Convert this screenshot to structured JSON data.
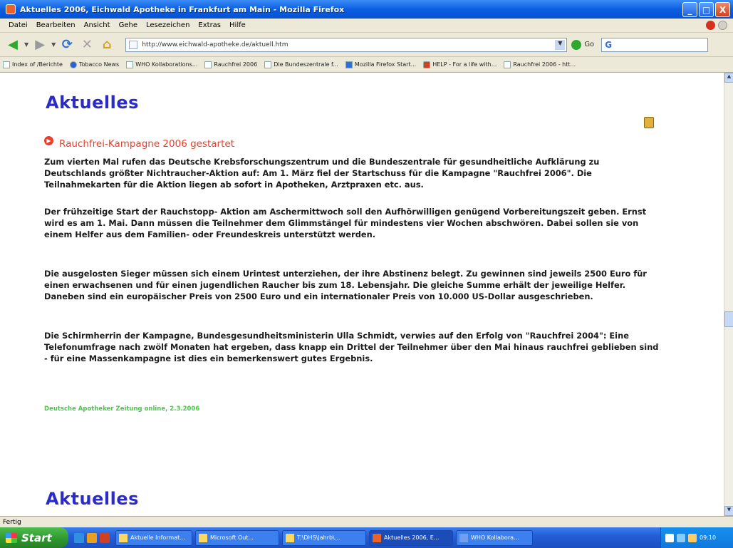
{
  "window": {
    "title": "Aktuelles 2006, Eichwald Apotheke in Frankfurt am Main - Mozilla Firefox",
    "controls": [
      "_",
      "□",
      "X"
    ]
  },
  "menu": [
    "Datei",
    "Bearbeiten",
    "Ansicht",
    "Gehe",
    "Lesezeichen",
    "Extras",
    "Hilfe"
  ],
  "toolbar": {
    "url": "http://www.eichwald-apotheke.de/aktuell.htm",
    "go_label": "Go",
    "search_placeholder": "G"
  },
  "bookmarks": [
    {
      "label": "Index of /Berichte",
      "icon": "page"
    },
    {
      "label": "Tobacco News",
      "icon": "google"
    },
    {
      "label": "WHO Kollaborations...",
      "icon": "page"
    },
    {
      "label": "Rauchfrei 2006",
      "icon": "page"
    },
    {
      "label": "Die Bundeszentrale f...",
      "icon": "page"
    },
    {
      "label": "Mozilla Firefox Start...",
      "icon": "firefox"
    },
    {
      "label": "HELP - For a life with...",
      "icon": "help"
    },
    {
      "label": "Rauchfrei 2006 - htt...",
      "icon": "page"
    }
  ],
  "content": {
    "heading": "Aktuelles",
    "heading_bottom": "Aktuelles",
    "news_title": "Rauchfrei-Kampagne 2006 gestartet",
    "paragraphs": [
      "Zum vierten Mal rufen das Deutsche Krebsforschungszentrum und die Bundeszentrale für gesundheitliche Aufklärung zu Deutschlands größter Nichtraucher-Aktion auf: Am 1. März fiel der Startschuss für die Kampagne \"Rauchfrei 2006\". Die Teilnahmekarten für die Aktion liegen ab sofort in Apotheken, Arztpraxen etc. aus.",
      "Der frühzeitige Start der Rauchstopp- Aktion am Aschermittwoch soll den Aufhörwilligen genügend Vorbereitungszeit geben. Ernst wird es am 1. Mai. Dann müssen die Teilnehmer dem Glimmstängel für mindestens vier Wochen abschwören. Dabei sollen sie von einem Helfer aus dem Familien- oder Freundeskreis unterstützt werden.",
      "Die ausgelosten Sieger müssen sich einem Urintest unterziehen, der ihre Abstinenz belegt. Zu gewinnen sind jeweils 2500 Euro für einen erwachsenen und für einen jugendlichen Raucher bis zum 18. Lebensjahr. Die gleiche Summe erhält der jeweilige Helfer. Daneben sind ein europäischer Preis von 2500 Euro und ein internationaler Preis von 10.000 US-Dollar ausgeschrieben.",
      "Die Schirmherrin der Kampagne, Bundesgesundheitsministerin Ulla Schmidt, verwies auf den Erfolg von \"Rauchfrei 2004\": Eine Telefonumfrage nach zwölf Monaten hat ergeben, dass knapp ein Drittel der Teilnehmer über den Mai hinaus rauchfrei geblieben sind - für eine Massenkampagne ist dies ein bemerkenswert gutes Ergebnis."
    ],
    "source": "Deutsche Apotheker Zeitung online, 2.3.2006"
  },
  "statusbar": {
    "text": "Fertig"
  },
  "taskbar": {
    "start_label": "Start",
    "tasks": [
      "Aktuelle Informat...",
      "Microsoft Out...",
      "T:\\DHS\\Jahrb\\...",
      "Aktuelles 2006, E...",
      "WHO Kollabora..."
    ],
    "clock": "09:10"
  }
}
